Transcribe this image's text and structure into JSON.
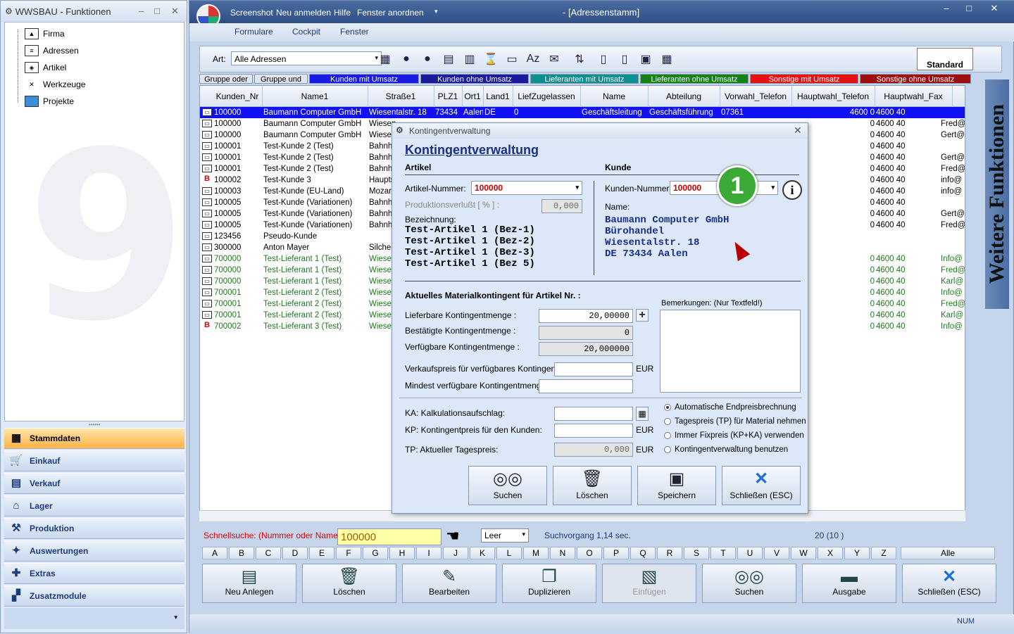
{
  "left": {
    "title": "WWSBAU - Funktionen",
    "tree": [
      "Firma",
      "Adressen",
      "Artikel",
      "Werkzeuge",
      "Projekte"
    ],
    "nav": [
      "Stammdaten",
      "Einkauf",
      "Verkauf",
      "Lager",
      "Produktion",
      "Auswertungen",
      "Extras",
      "Zusatzmodule"
    ]
  },
  "main": {
    "title": "- [Adressenstamm]",
    "quick": [
      "Screenshot",
      "Neu anmelden",
      "Hilfe",
      "Fenster anordnen"
    ],
    "menu": [
      "Formulare",
      "Cockpit",
      "Fenster"
    ],
    "art_label": "Art:",
    "art_value": "Alle Adressen",
    "standard": "Standard",
    "banner": "Weitere Funktionen",
    "groups": [
      {
        "t": "Gruppe oder",
        "c": "#dfe6f0",
        "f": "#000"
      },
      {
        "t": "Gruppe und",
        "c": "#dfe6f0",
        "f": "#000"
      },
      {
        "t": "Kunden mit Umsatz",
        "c": "#1a1ae6",
        "f": "#fff"
      },
      {
        "t": "Kunden ohne Umsatz",
        "c": "#1a1a9c",
        "f": "#fff"
      },
      {
        "t": "Lieferanten mit Umsatz",
        "c": "#0e8f8f",
        "f": "#fff"
      },
      {
        "t": "Lieferanten ohne Umsatz",
        "c": "#148214",
        "f": "#fff"
      },
      {
        "t": "Sonstige mit Umsatz",
        "c": "#e81212",
        "f": "#fff"
      },
      {
        "t": "Sonstige ohne Umsatz",
        "c": "#9e1010",
        "f": "#fff"
      }
    ],
    "columns": [
      "Kunden_Nr",
      "Name1",
      "Straße1",
      "PLZ1",
      "Ort1",
      "Land1",
      "LiefZugelassen",
      "Name",
      "Abteilung",
      "Vorwahl_Telefon",
      "Hauptwahl_Telefon",
      "Hauptwahl_Fax"
    ],
    "rows": [
      {
        "i": "doc",
        "nr": "100000",
        "n": "Baumann Computer GmbH",
        "s": "Wiesentalstr. 18",
        "plz": "73434",
        "ort": "Aalen",
        "land": "DE",
        "lz": "0",
        "name": "Geschäftsleitung",
        "abt": "Geschäftsführung",
        "vw": "07361",
        "hw": "4600 0",
        "fax": "4600 40",
        "x": "",
        "sel": true
      },
      {
        "i": "doc",
        "nr": "100000",
        "n": "Baumann Computer GmbH",
        "s": "Wiesen",
        "hw": "0",
        "fax": "4600 40",
        "x": "Fred@"
      },
      {
        "i": "doc",
        "nr": "100000",
        "n": "Baumann Computer GmbH",
        "s": "Wiesen",
        "hw": "0",
        "fax": "4600 40",
        "x": "Gert@"
      },
      {
        "i": "doc",
        "nr": "100001",
        "n": "Test-Kunde 2  (Test)",
        "s": "Bahnh",
        "hw": "0",
        "fax": "4600 40",
        "x": ""
      },
      {
        "i": "doc",
        "nr": "100001",
        "n": "Test-Kunde 2  (Test)",
        "s": "Bahnh",
        "hw": "0",
        "fax": "4600 40",
        "x": "Gert@"
      },
      {
        "i": "doc",
        "nr": "100001",
        "n": "Test-Kunde 2  (Test)",
        "s": "Bahnh",
        "hw": "0",
        "fax": "4600 40",
        "x": "Fred@"
      },
      {
        "i": "b",
        "nr": "100002",
        "n": "Test-Kunde 3",
        "s": "Haupts",
        "hw": "0",
        "fax": "4600 40",
        "x": "info@"
      },
      {
        "i": "doc",
        "nr": "100003",
        "n": "Test-Kunde (EU-Land)",
        "s": "Mozart",
        "hw": "0",
        "fax": "4600 40",
        "x": "info@"
      },
      {
        "i": "doc",
        "nr": "100005",
        "n": "Test-Kunde (Variationen)",
        "s": "Bahnh",
        "hw": "0",
        "fax": "4600 40",
        "x": ""
      },
      {
        "i": "doc",
        "nr": "100005",
        "n": "Test-Kunde (Variationen)",
        "s": "Bahnh",
        "hw": "0",
        "fax": "4600 40",
        "x": "Gert@"
      },
      {
        "i": "doc",
        "nr": "100005",
        "n": "Test-Kunde (Variationen)",
        "s": "Bahnh",
        "hw": "0",
        "fax": "4600 40",
        "x": "Fred@"
      },
      {
        "i": "doc",
        "nr": "123456",
        "n": "Pseudo-Kunde",
        "s": "",
        "hw": "",
        "fax": "",
        "x": ""
      },
      {
        "i": "doc",
        "nr": "300000",
        "n": "Anton Mayer",
        "s": "Silcher",
        "hw": "",
        "fax": "",
        "x": ""
      },
      {
        "i": "doc",
        "nr": "700000",
        "n": "Test-Lieferant 1  (Test)",
        "s": "Wiesen",
        "hw": "0",
        "fax": "4600 40",
        "x": "Info@",
        "g": true
      },
      {
        "i": "doc",
        "nr": "700000",
        "n": "Test-Lieferant 1  (Test)",
        "s": "Wiesen",
        "hw": "0",
        "fax": "4600 40",
        "x": "Fred@",
        "g": true
      },
      {
        "i": "doc",
        "nr": "700000",
        "n": "Test-Lieferant 1  (Test)",
        "s": "Wiesen",
        "hw": "0",
        "fax": "4600 40",
        "x": "Karl@",
        "g": true
      },
      {
        "i": "doc",
        "nr": "700001",
        "n": "Test-Lieferant 2  (Test)",
        "s": "Wiesen",
        "hw": "0",
        "fax": "4600 40",
        "x": "Info@",
        "g": true
      },
      {
        "i": "doc",
        "nr": "700001",
        "n": "Test-Lieferant 2  (Test)",
        "s": "Wiesen",
        "hw": "0",
        "fax": "4600 40",
        "x": "Fred@",
        "g": true
      },
      {
        "i": "doc",
        "nr": "700001",
        "n": "Test-Lieferant 2  (Test)",
        "s": "Wiesen",
        "hw": "0",
        "fax": "4600 40",
        "x": "Karl@",
        "g": true
      },
      {
        "i": "b",
        "nr": "700002",
        "n": "Test-Lieferant 3  (Test)",
        "s": "Wiesen",
        "hw": "0",
        "fax": "4600 40",
        "x": "Info@",
        "g": true
      }
    ],
    "search_label": "Schnellsuche: (Nummer oder Name) :",
    "search_value": "100000",
    "leer": "Leer",
    "suchvorgang": "Suchvorgang 1,14 sec.",
    "count": "20  (10 )",
    "alphabet": [
      "A",
      "B",
      "C",
      "D",
      "E",
      "F",
      "G",
      "H",
      "I",
      "J",
      "K",
      "L",
      "M",
      "N",
      "O",
      "P",
      "Q",
      "R",
      "S",
      "T",
      "U",
      "V",
      "W",
      "X",
      "Y",
      "Z"
    ],
    "alle": "Alle",
    "buttons": [
      "Neu Anlegen",
      "Löschen",
      "Bearbeiten",
      "Duplizieren",
      "Einfügen",
      "Suchen",
      "Ausgabe",
      "Schließen (ESC)"
    ],
    "num": "NUM"
  },
  "dialog": {
    "title": "Kontingentverwaltung",
    "heading": "Kontingentverwaltung",
    "artikel": "Artikel",
    "kunde": "Kunde",
    "artnr_label": "Artikel-Nummer:",
    "artnr": "100000",
    "prodv_label": "Produktionsverlußt [ % ] :",
    "prodv": "0,000",
    "bez_label": "Bezeichnung:",
    "bez": [
      "Test-Artikel 1  (Bez-1)",
      "Test-Artikel 1  (Bez-2)",
      "Test-Artikel 1  (Bez-3)",
      "Test-Artikel 1  (Bez 5)"
    ],
    "kdnr_label": "Kunden-Nummer:",
    "kdnr": "100000",
    "name_label": "Name:",
    "kname": [
      "Baumann Computer GmbH",
      "Bürohandel",
      "Wiesentalstr. 18",
      "DE 73434 Aalen"
    ],
    "section": "Aktuelles Materialkontingent für Artikel Nr. :",
    "lief_label": "Lieferbare Kontingentmenge :",
    "lief": "20,00000",
    "best_label": "Bestätigte Kontingentmenge :",
    "best": "0",
    "verf_label": "Verfügbare Kontingentmenge :",
    "verf": "20,000000",
    "bem_label": "Bemerkungen:  (Nur Textfeld!)",
    "vk_label": "Verkaufspreis für verfügbares Kontingent :",
    "eur": "EUR",
    "min_label": "Mindest verfügbare Kontingentmenge :",
    "ka_label": "KA: Kalkulationsaufschlag:",
    "kp_label": "KP: Kontingentpreis für den Kunden:",
    "tp_label": "TP: Aktueller Tagespreis:",
    "tp": "0,000",
    "radios": [
      "Automatische Endpreisbrechnung",
      "Tagespreis (TP) für Material nehmen",
      "Immer Fixpreis (KP+KA) verwenden",
      "Kontingentverwaltung benutzen"
    ],
    "buttons": [
      "Suchen",
      "Löschen",
      "Speichern",
      "Schließen (ESC)"
    ],
    "badge": "1"
  }
}
